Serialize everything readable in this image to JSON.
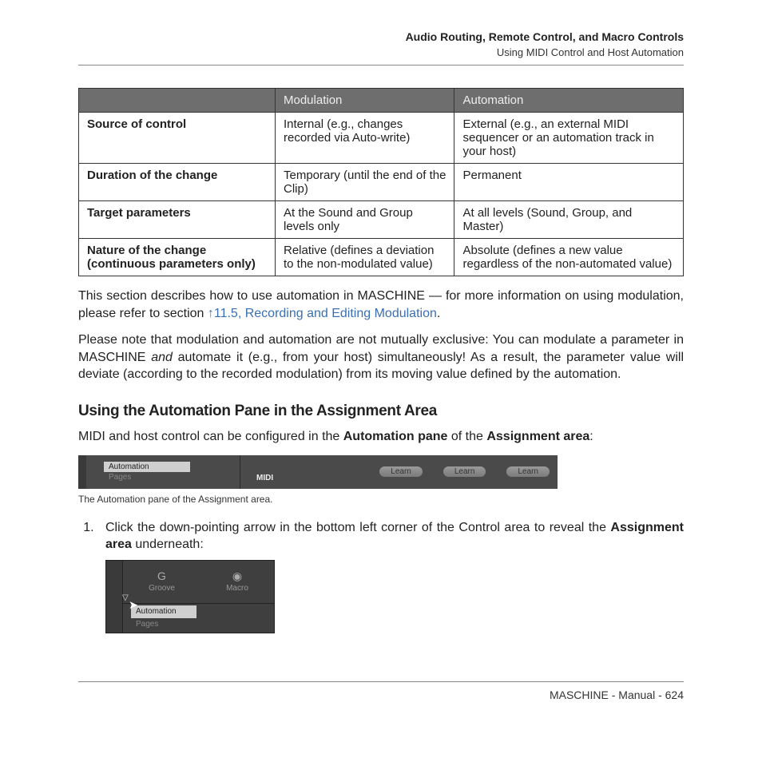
{
  "header": {
    "title": "Audio Routing, Remote Control, and Macro Controls",
    "subtitle": "Using MIDI Control and Host Automation"
  },
  "table": {
    "col1": "Modulation",
    "col2": "Automation",
    "rows": [
      {
        "label": "Source of control",
        "c1": "Internal (e.g., changes recorded via Auto-write)",
        "c2": "External (e.g., an external MIDI sequencer or an automation track in your host)"
      },
      {
        "label": "Duration of the change",
        "c1": "Temporary (until the end of the Clip)",
        "c2": "Permanent"
      },
      {
        "label": "Target parameters",
        "c1": "At the Sound and Group levels only",
        "c2": "At all levels (Sound, Group, and Master)"
      },
      {
        "label": "Nature of the change (continuous parameters only)",
        "c1": "Relative (defines a deviation to the non-modulated value)",
        "c2": "Absolute (defines a new value regardless of the non-automated value)"
      }
    ]
  },
  "para1_a": "This section describes how to use automation in MASCHINE — for more information on using modulation, please refer to section ",
  "para1_link": "↑11.5, Recording and Editing Modulation",
  "para1_b": ".",
  "para2_a": "Please note that modulation and automation are not mutually exclusive: You can modulate a parameter in MASCHINE ",
  "para2_i": "and",
  "para2_b": " automate it (e.g., from your host) simultaneously! As a result, the parameter value will deviate (according to the recorded modulation) from its moving value defined by the automation.",
  "heading2": "Using the Automation Pane in the Assignment Area",
  "para3_a": "MIDI and host control can be configured in the ",
  "para3_b1": "Automation pane",
  "para3_mid": " of the ",
  "para3_b2": "Assignment area",
  "para3_end": ":",
  "pane": {
    "tab": "Automation",
    "sub": "Pages",
    "midi": "MIDI",
    "learn": "Learn"
  },
  "caption1": "The Automation pane of the Assignment area.",
  "step1_a": "Click the down-pointing arrow in the bottom left corner of the Control area to reveal the ",
  "step1_b": "Assignment area",
  "step1_c": " underneath:",
  "ctrl": {
    "groove": "Groove",
    "macro": "Macro",
    "automation": "Automation",
    "pages": "Pages"
  },
  "footer": "MASCHINE - Manual - 624"
}
